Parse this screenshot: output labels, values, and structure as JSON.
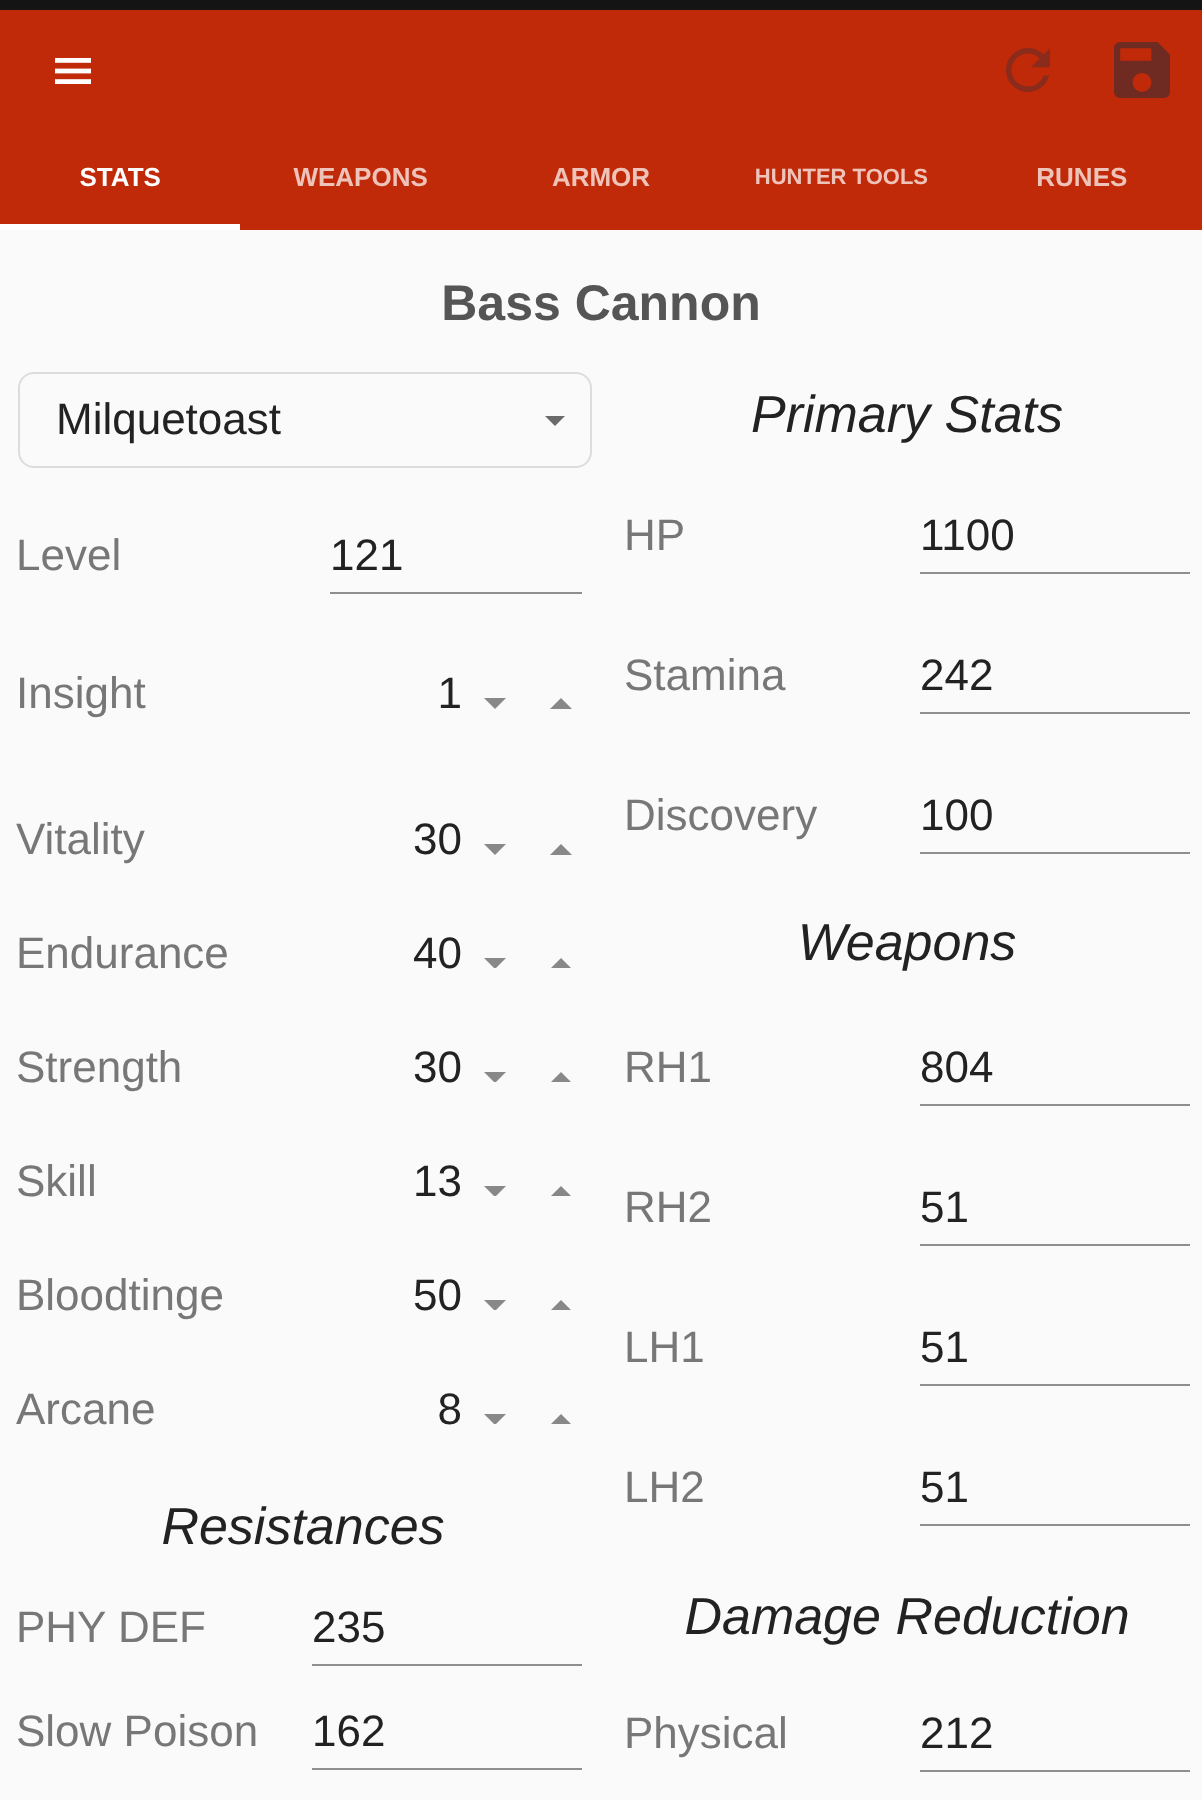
{
  "app_bar": {
    "tabs": [
      {
        "label": "STATS",
        "selected": true
      },
      {
        "label": "WEAPONS",
        "selected": false
      },
      {
        "label": "ARMOR",
        "selected": false
      },
      {
        "label": "HUNTER TOOLS",
        "selected": false
      },
      {
        "label": "RUNES",
        "selected": false
      }
    ]
  },
  "title": "Bass Cannon",
  "origin_select": {
    "value": "Milquetoast"
  },
  "level": {
    "label": "Level",
    "value": "121"
  },
  "attributes": [
    {
      "label": "Insight",
      "value": "1"
    },
    {
      "label": "Vitality",
      "value": "30"
    },
    {
      "label": "Endurance",
      "value": "40"
    },
    {
      "label": "Strength",
      "value": "30"
    },
    {
      "label": "Skill",
      "value": "13"
    },
    {
      "label": "Bloodtinge",
      "value": "50"
    },
    {
      "label": "Arcane",
      "value": "8"
    }
  ],
  "resistances": {
    "heading": "Resistances",
    "fields": [
      {
        "label": "PHY DEF",
        "value": "235"
      },
      {
        "label": "Slow Poison",
        "value": "162"
      }
    ]
  },
  "primary_stats": {
    "heading": "Primary Stats",
    "fields": [
      {
        "label": "HP",
        "value": "1100"
      },
      {
        "label": "Stamina",
        "value": "242"
      },
      {
        "label": "Discovery",
        "value": "100"
      }
    ]
  },
  "weapons": {
    "heading": "Weapons",
    "fields": [
      {
        "label": "RH1",
        "value": "804"
      },
      {
        "label": "RH2",
        "value": "51"
      },
      {
        "label": "LH1",
        "value": "51"
      },
      {
        "label": "LH2",
        "value": "51"
      }
    ]
  },
  "damage_reduction": {
    "heading": "Damage Reduction",
    "fields": [
      {
        "label": "Physical",
        "value": "212"
      }
    ]
  }
}
